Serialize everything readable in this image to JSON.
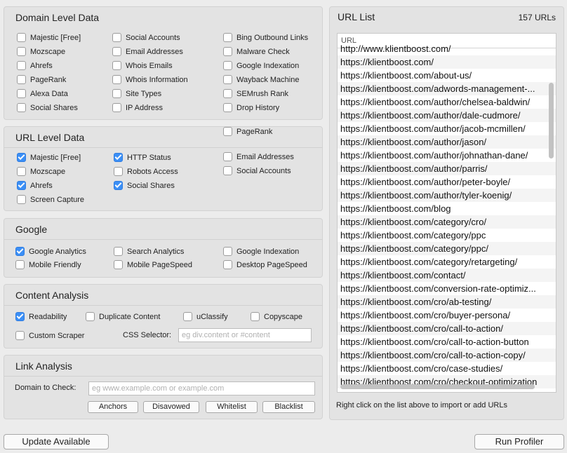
{
  "domain_level": {
    "title": "Domain Level Data",
    "items": [
      {
        "label": "Majestic [Free]",
        "checked": false
      },
      {
        "label": "Social Accounts",
        "checked": false
      },
      {
        "label": "Bing Outbound Links",
        "checked": false
      },
      {
        "label": "Mozscape",
        "checked": false
      },
      {
        "label": "Email Addresses",
        "checked": false
      },
      {
        "label": "Malware Check",
        "checked": false
      },
      {
        "label": "Ahrefs",
        "checked": false
      },
      {
        "label": "Whois Emails",
        "checked": false
      },
      {
        "label": "Google Indexation",
        "checked": false
      },
      {
        "label": "PageRank",
        "checked": false
      },
      {
        "label": "Whois Information",
        "checked": false
      },
      {
        "label": "Wayback Machine",
        "checked": false
      },
      {
        "label": "Alexa Data",
        "checked": false
      },
      {
        "label": "Site Types",
        "checked": false
      },
      {
        "label": "SEMrush Rank",
        "checked": false
      },
      {
        "label": "Social Shares",
        "checked": false
      },
      {
        "label": "IP Address",
        "checked": false
      },
      {
        "label": "Drop History",
        "checked": false
      }
    ]
  },
  "url_level": {
    "title": "URL Level Data",
    "items": [
      {
        "label": "Majestic [Free]",
        "checked": true
      },
      {
        "label": "HTTP Status",
        "checked": true
      },
      {
        "label": "Email Addresses",
        "checked": false
      },
      {
        "label": "Mozscape",
        "checked": false
      },
      {
        "label": "Robots Access",
        "checked": false
      },
      {
        "label": "Social Accounts",
        "checked": false
      },
      {
        "label": "Ahrefs",
        "checked": true
      },
      {
        "label": "Social Shares",
        "checked": true
      },
      {
        "label": "PageRank",
        "checked": false
      },
      {
        "label": "Screen Capture",
        "checked": false
      }
    ]
  },
  "google": {
    "title": "Google",
    "items": [
      {
        "label": "Google Analytics",
        "checked": true
      },
      {
        "label": "Search Analytics",
        "checked": false
      },
      {
        "label": "Google Indexation",
        "checked": false
      },
      {
        "label": "Mobile Friendly",
        "checked": false
      },
      {
        "label": "Mobile PageSpeed",
        "checked": false
      },
      {
        "label": "Desktop PageSpeed",
        "checked": false
      }
    ]
  },
  "content_analysis": {
    "title": "Content Analysis",
    "items": [
      {
        "label": "Readability",
        "checked": true
      },
      {
        "label": "Duplicate Content",
        "checked": false
      },
      {
        "label": "uClassify",
        "checked": false
      },
      {
        "label": "Copyscape",
        "checked": false
      },
      {
        "label": "Custom Scraper",
        "checked": false
      }
    ],
    "css_selector_label": "CSS Selector:",
    "css_selector_value": "",
    "css_selector_placeholder": "eg div.content or #content"
  },
  "link_analysis": {
    "title": "Link Analysis",
    "domain_label": "Domain to Check:",
    "domain_value": "",
    "domain_placeholder": "eg www.example.com or example.com",
    "buttons": [
      "Anchors",
      "Disavowed",
      "Whitelist",
      "Blacklist"
    ]
  },
  "url_list": {
    "title": "URL List",
    "count": "157 URLs",
    "column_header": "URL",
    "rows": [
      "http://www.klientboost.com/",
      "https://klientboost.com/",
      "https://klientboost.com/about-us/",
      "https://klientboost.com/adwords-management-...",
      "https://klientboost.com/author/chelsea-baldwin/",
      "https://klientboost.com/author/dale-cudmore/",
      "https://klientboost.com/author/jacob-mcmillen/",
      "https://klientboost.com/author/jason/",
      "https://klientboost.com/author/johnathan-dane/",
      "https://klientboost.com/author/parris/",
      "https://klientboost.com/author/peter-boyle/",
      "https://klientboost.com/author/tyler-koenig/",
      "https://klientboost.com/blog",
      "https://klientboost.com/category/cro/",
      "https://klientboost.com/category/ppc",
      "https://klientboost.com/category/ppc/",
      "https://klientboost.com/category/retargeting/",
      "https://klientboost.com/contact/",
      "https://klientboost.com/conversion-rate-optimiz...",
      "https://klientboost.com/cro/ab-testing/",
      "https://klientboost.com/cro/buyer-persona/",
      "https://klientboost.com/cro/call-to-action/",
      "https://klientboost.com/cro/call-to-action-button",
      "https://klientboost.com/cro/call-to-action-copy/",
      "https://klientboost.com/cro/case-studies/",
      "https://klientboost.com/cro/checkout-optimization"
    ],
    "hint": "Right click on the list above to import or add URLs"
  },
  "footer": {
    "update_label": "Update Available",
    "run_label": "Run Profiler"
  }
}
